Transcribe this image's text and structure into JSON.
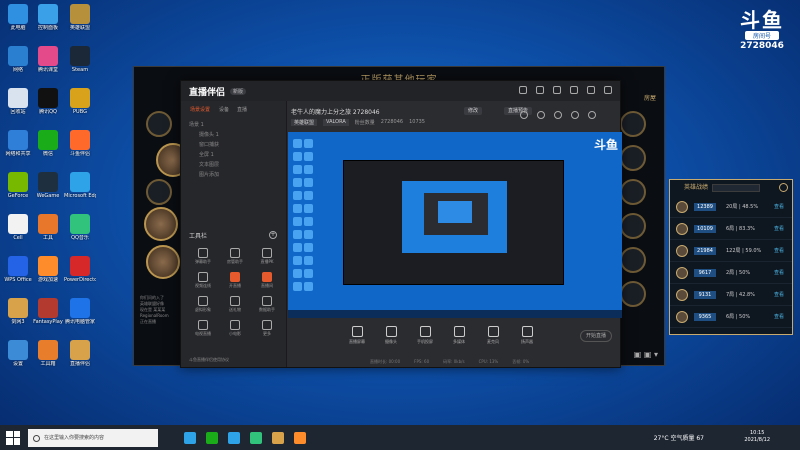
{
  "desktop": {
    "icons": [
      {
        "label": "此电脑",
        "color": "#2f8fe0"
      },
      {
        "label": "控制面板",
        "color": "#3aa0e8"
      },
      {
        "label": "英雄联盟",
        "color": "#b7903c"
      },
      {
        "label": "网络",
        "color": "#2a7fd0"
      },
      {
        "label": "腾讯课堂",
        "color": "#e44a8a"
      },
      {
        "label": "Steam",
        "color": "#1b2838"
      },
      {
        "label": "回收站",
        "color": "#d8e3ef"
      },
      {
        "label": "腾讯QQ",
        "color": "#111111"
      },
      {
        "label": "PUBG",
        "color": "#d9a21b"
      },
      {
        "label": "网络和共享",
        "color": "#2f7ed8"
      },
      {
        "label": "微信",
        "color": "#1aad19"
      },
      {
        "label": "斗鱼伴侣",
        "color": "#ff6a2b"
      },
      {
        "label": "GeForce",
        "color": "#76b900"
      },
      {
        "label": "WeGame",
        "color": "#1e3040"
      },
      {
        "label": "Microsoft Edge",
        "color": "#2fa3e8"
      },
      {
        "label": "Cell",
        "color": "#f2f2f2"
      },
      {
        "label": "工具",
        "color": "#e8762b"
      },
      {
        "label": "QQ音乐",
        "color": "#31c27c"
      },
      {
        "label": "WPS Office",
        "color": "#2462e6"
      },
      {
        "label": "游戏加速",
        "color": "#ff8c2b"
      },
      {
        "label": "PowerDirector",
        "color": "#d62828"
      },
      {
        "label": "剑网3",
        "color": "#d8a24a"
      },
      {
        "label": "FantasyPlay",
        "color": "#b23a2e"
      },
      {
        "label": "腾讯电脑管家",
        "color": "#1e73e8"
      },
      {
        "label": "设置",
        "color": "#3b8bd6"
      },
      {
        "label": "工具箱",
        "color": "#e87d2b"
      },
      {
        "label": "直播伴侣",
        "color": "#d8a24a"
      }
    ]
  },
  "brand": {
    "logo": "斗鱼",
    "tag": "房间号",
    "room": "2728046"
  },
  "game": {
    "title": "正版获其他玩家",
    "top_right": "房屋",
    "chat": [
      "你们问的入了",
      "英雄联盟好像",
      "现在是 某某某",
      "RegionalRoom",
      "正在直播"
    ]
  },
  "streamer": {
    "logo": "直播伴侣",
    "version": "新版",
    "tabs": [
      "场景设置",
      "设备",
      "直播"
    ],
    "scenes": [
      "场景 1",
      "摄像头 1",
      "窗口捕获",
      "全屏 1",
      "文本图层",
      "图片添加"
    ],
    "section_label": "工具栏",
    "tools": [
      "弹幕助手",
      "房管助手",
      "直播PK",
      "视频连线",
      "开直播",
      "直播间",
      "虚拟形象",
      "送礼物",
      "数据助手",
      "电视直播",
      "小电影",
      "更多"
    ],
    "footer": "斗鱼直播伴侣使用协议",
    "room_title": "老牛人的魔力上分之旅 2728046",
    "btn_modify": "修改",
    "btn_ok": "直播预告",
    "meta": {
      "category": "英雄联盟",
      "game_mode": "VALORA",
      "fans_label": "粉丝数量",
      "fans": "2728046",
      "hot": "10735"
    },
    "preview_brand": "斗鱼",
    "actions": [
      "直播屏幕",
      "摄像头",
      "手机投屏",
      "多媒体",
      "麦克风",
      "扬声器"
    ],
    "stop": "开始直播",
    "status": [
      "直播时长: 00:00",
      "FPS: 60",
      "码率: 0kb/s",
      "CPU: 13%",
      "丢帧: 0%"
    ]
  },
  "rank": {
    "title": "英雄战绩",
    "rows": [
      {
        "score": "12389",
        "record": "20局 | 48.5%",
        "view": "查看"
      },
      {
        "score": "10109",
        "record": "6局 | 83.3%",
        "view": "查看"
      },
      {
        "score": "21984",
        "record": "122局 | 59.0%",
        "view": "查看"
      },
      {
        "score": "9617",
        "record": "2局 | 50%",
        "view": "查看"
      },
      {
        "score": "9131",
        "record": "7局 | 42.8%",
        "view": "查看"
      },
      {
        "score": "9365",
        "record": "6局 | 50%",
        "view": "查看"
      }
    ]
  },
  "taskbar": {
    "search_placeholder": "在这里输入你要搜索的内容",
    "weather": "27°C 空气质量 67",
    "time": "10:15",
    "date": "2021/8/12",
    "apps": [
      "#2fa3e8",
      "#1aad19",
      "#2fa3e8",
      "#31c27c",
      "#d8a24a",
      "#ff8c2b"
    ]
  }
}
